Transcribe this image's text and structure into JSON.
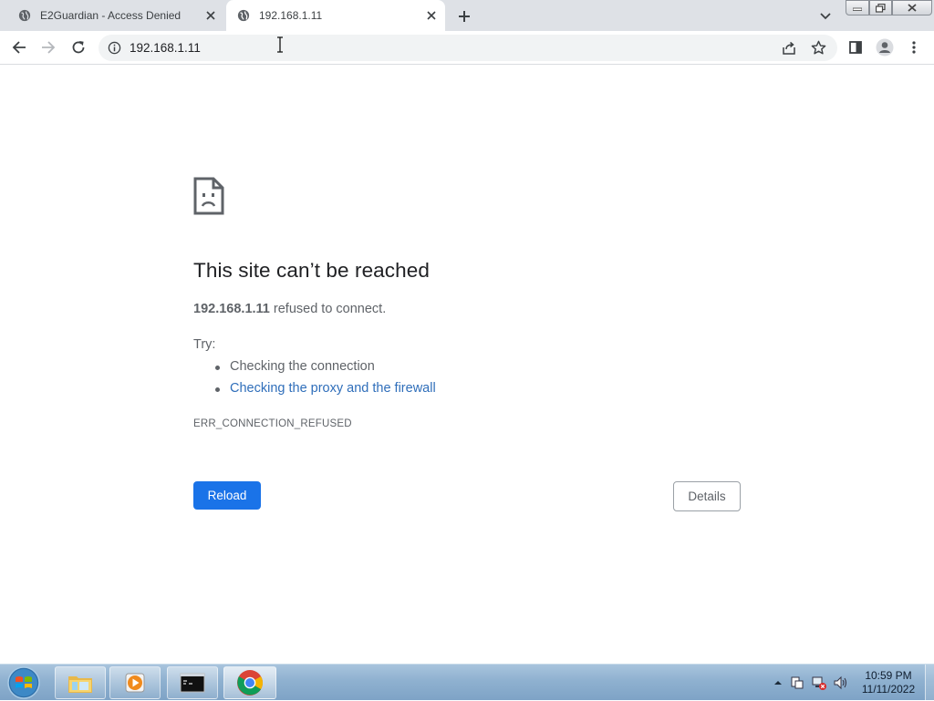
{
  "tabs": [
    {
      "title": "E2Guardian - Access Denied",
      "active": false
    },
    {
      "title": "192.168.1.11",
      "active": true
    }
  ],
  "toolbar": {
    "url": "192.168.1.11"
  },
  "error_page": {
    "heading": "This site can’t be reached",
    "host": "192.168.1.11",
    "message": " refused to connect.",
    "try_label": "Try:",
    "suggestions": [
      "Checking the connection",
      "Checking the proxy and the firewall"
    ],
    "error_code": "ERR_CONNECTION_REFUSED",
    "reload_label": "Reload",
    "details_label": "Details"
  },
  "taskbar": {
    "apps": [
      "explorer-icon",
      "media-player-icon",
      "terminal-icon",
      "chrome-icon"
    ],
    "clock_time": "10:59 PM",
    "clock_date": "11/11/2022"
  },
  "colors": {
    "accent": "#1a73e8",
    "link": "#2f6eba",
    "tab_strip": "#dee1e6"
  }
}
